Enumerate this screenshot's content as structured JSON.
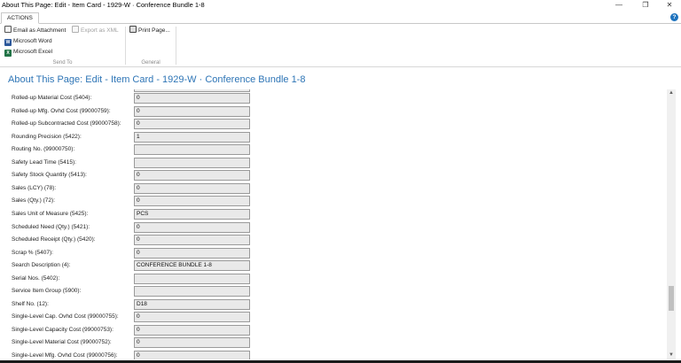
{
  "window": {
    "title": "About This Page: Edit - Item Card - 1929-W · Conference Bundle 1-8",
    "minimize_icon": "minimize-icon",
    "restore_icon": "restore-icon",
    "close_icon": "close-icon"
  },
  "ribbon": {
    "tab": "ACTIONS",
    "help": "?",
    "send_to": {
      "caption": "Send To",
      "email": "Email as Attachment",
      "xml": "Export as XML",
      "word": "Microsoft Word",
      "excel": "Microsoft Excel"
    },
    "general": {
      "caption": "General",
      "print": "Print Page..."
    }
  },
  "page": {
    "header": "About This Page: Edit - Item Card - 1929-W · Conference Bundle 1-8"
  },
  "fields": [
    {
      "label": "Rolled-up Material Cost (5404):",
      "value": "0"
    },
    {
      "label": "Rolled-up Mfg. Ovhd Cost (99000759):",
      "value": "0"
    },
    {
      "label": "Rolled-up Subcontracted Cost (99000758):",
      "value": "0"
    },
    {
      "label": "Rounding Precision (5422):",
      "value": "1"
    },
    {
      "label": "Routing No. (99000750):",
      "value": ""
    },
    {
      "label": "Safety Lead Time (5415):",
      "value": ""
    },
    {
      "label": "Safety Stock Quantity (5413):",
      "value": "0"
    },
    {
      "label": "Sales (LCY) (78):",
      "value": "0"
    },
    {
      "label": "Sales (Qty.) (72):",
      "value": "0"
    },
    {
      "label": "Sales Unit of Measure (5425):",
      "value": "PCS"
    },
    {
      "label": "Scheduled Need (Qty.) (5421):",
      "value": "0"
    },
    {
      "label": "Scheduled Receipt (Qty.) (5420):",
      "value": "0"
    },
    {
      "label": "Scrap % (5407):",
      "value": "0"
    },
    {
      "label": "Search Description (4):",
      "value": "CONFERENCE BUNDLE 1-8"
    },
    {
      "label": "Serial Nos. (5402):",
      "value": ""
    },
    {
      "label": "Service Item Group (5900):",
      "value": ""
    },
    {
      "label": "Shelf No. (12):",
      "value": "D18"
    },
    {
      "label": "Single-Level Cap. Ovhd Cost (99000755):",
      "value": "0"
    },
    {
      "label": "Single-Level Capacity Cost (99000753):",
      "value": "0"
    },
    {
      "label": "Single-Level Material Cost (99000752):",
      "value": "0"
    },
    {
      "label": "Single-Level Mfg. Ovhd Cost (99000756):",
      "value": "0"
    }
  ],
  "colors": {
    "accent": "#2e75b6",
    "field_bg": "#e9e9e9"
  }
}
